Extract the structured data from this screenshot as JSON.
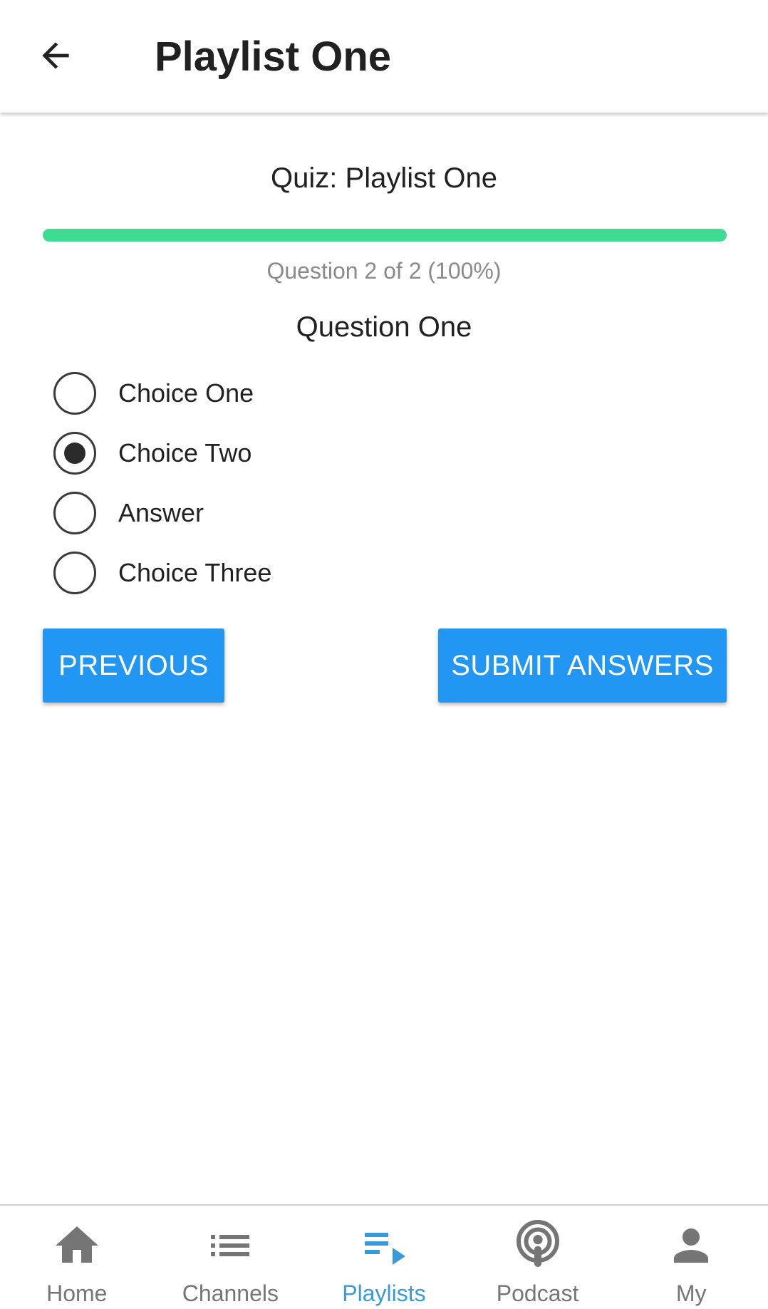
{
  "app_bar": {
    "title": "Playlist One",
    "back_icon": "arrow-left-icon"
  },
  "quiz": {
    "title": "Quiz: Playlist One",
    "progress_fraction": 1.0,
    "progress_text": "Question 2 of 2 (100%)",
    "question_title": "Question One",
    "choices": [
      {
        "label": "Choice One",
        "selected": false
      },
      {
        "label": "Choice Two",
        "selected": true
      },
      {
        "label": "Answer",
        "selected": false
      },
      {
        "label": "Choice Three",
        "selected": false
      }
    ],
    "previous_label": "PREVIOUS",
    "submit_label": "SUBMIT ANSWERS"
  },
  "bottom_nav": {
    "items": [
      {
        "label": "Home",
        "icon": "home-icon",
        "active": false
      },
      {
        "label": "Channels",
        "icon": "list-icon",
        "active": false
      },
      {
        "label": "Playlists",
        "icon": "playlist-play-icon",
        "active": true
      },
      {
        "label": "Podcast",
        "icon": "podcast-icon",
        "active": false
      },
      {
        "label": "My",
        "icon": "person-icon",
        "active": false
      }
    ]
  },
  "colors": {
    "progress_fill": "#3ddc91",
    "button": "#2196f3",
    "nav_active": "#3a9ad9",
    "nav_inactive": "#757575"
  }
}
